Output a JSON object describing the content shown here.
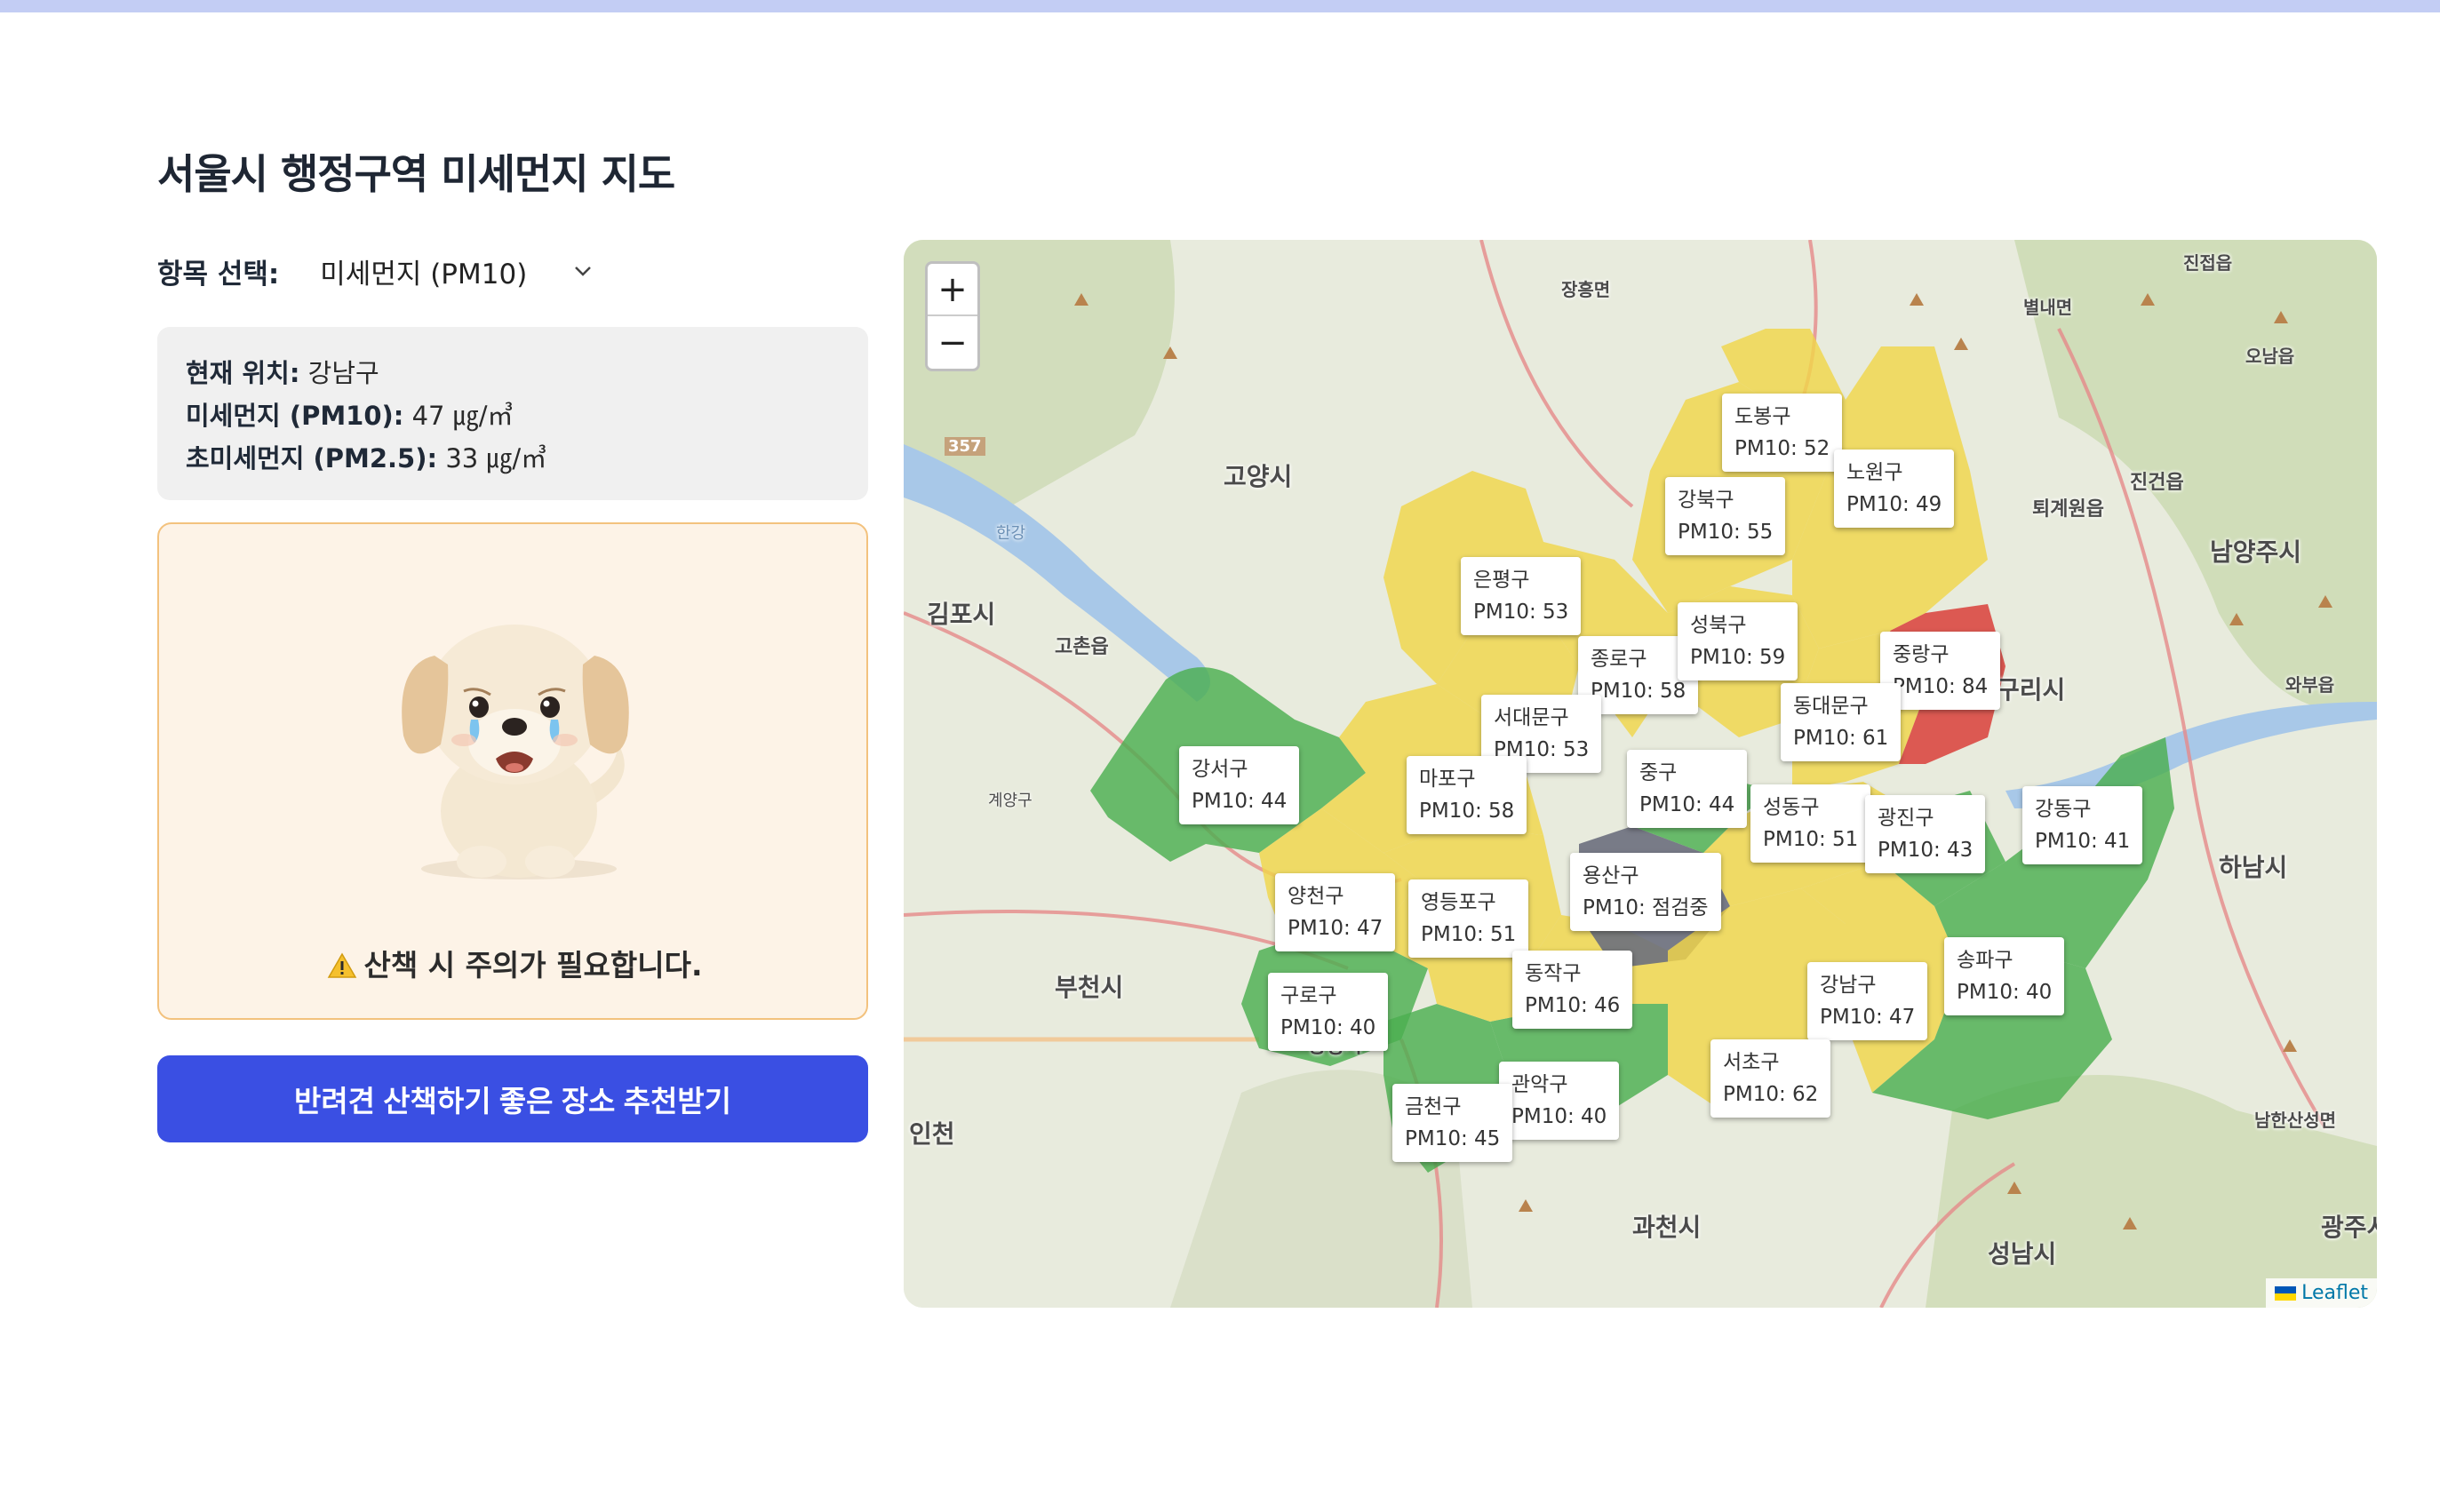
{
  "page": {
    "title": "서울시 행정구역 미세먼지 지도"
  },
  "selector": {
    "label": "항목 선택:",
    "value": "미세먼지 (PM10)"
  },
  "status": {
    "location_label": "현재 위치:",
    "location_value": "강남구",
    "pm10_label": "미세먼지 (PM10):",
    "pm10_value": "47 ㎍/㎥",
    "pm25_label": "초미세먼지 (PM2.5):",
    "pm25_value": "33 ㎍/㎥"
  },
  "advice": {
    "message": "산책 시 주의가 필요합니다.",
    "icon": "warning-icon",
    "mascot": "sad-puppy"
  },
  "cta": {
    "label": "반려견 산책하기 좋은 장소 추천받기"
  },
  "colors": {
    "good": "#4caf50",
    "moderate": "#f0d54a",
    "bad": "#d9403a",
    "unknown": "#6b6f7d",
    "accent": "#3a4fe3"
  },
  "map": {
    "zoom_in": "+",
    "zoom_out": "−",
    "attribution": "Leaflet",
    "districts": [
      {
        "name": "도봉구",
        "value": "PM10: 52",
        "level": "moderate"
      },
      {
        "name": "노원구",
        "value": "PM10: 49",
        "level": "moderate"
      },
      {
        "name": "강북구",
        "value": "PM10: 55",
        "level": "moderate"
      },
      {
        "name": "은평구",
        "value": "PM10: 53",
        "level": "moderate"
      },
      {
        "name": "종로구",
        "value": "PM10: 58",
        "level": "moderate"
      },
      {
        "name": "성북구",
        "value": "PM10: 59",
        "level": "moderate"
      },
      {
        "name": "중랑구",
        "value": "PM10: 84",
        "level": "bad"
      },
      {
        "name": "동대문구",
        "value": "PM10: 61",
        "level": "moderate"
      },
      {
        "name": "서대문구",
        "value": "PM10: 53",
        "level": "moderate"
      },
      {
        "name": "강서구",
        "value": "PM10: 44",
        "level": "good"
      },
      {
        "name": "마포구",
        "value": "PM10: 58",
        "level": "moderate"
      },
      {
        "name": "중구",
        "value": "PM10: 44",
        "level": "good"
      },
      {
        "name": "성동구",
        "value": "PM10: 51",
        "level": "moderate"
      },
      {
        "name": "광진구",
        "value": "PM10: 43",
        "level": "good"
      },
      {
        "name": "강동구",
        "value": "PM10: 41",
        "level": "good"
      },
      {
        "name": "용산구",
        "value": "PM10: 점검중",
        "level": "unknown"
      },
      {
        "name": "양천구",
        "value": "PM10: 47",
        "level": "moderate"
      },
      {
        "name": "영등포구",
        "value": "PM10: 51",
        "level": "moderate"
      },
      {
        "name": "송파구",
        "value": "PM10: 40",
        "level": "good"
      },
      {
        "name": "동작구",
        "value": "PM10: 46",
        "level": "moderate"
      },
      {
        "name": "강남구",
        "value": "PM10: 47",
        "level": "moderate"
      },
      {
        "name": "구로구",
        "value": "PM10: 40",
        "level": "good"
      },
      {
        "name": "서초구",
        "value": "PM10: 62",
        "level": "moderate"
      },
      {
        "name": "관악구",
        "value": "PM10: 40",
        "level": "good"
      },
      {
        "name": "금천구",
        "value": "PM10: 45",
        "level": "moderate"
      }
    ],
    "places": [
      "장흥면",
      "진접읍",
      "별내면",
      "오남읍",
      "고양시",
      "진건읍",
      "퇴계원읍",
      "남양주시",
      "김포시",
      "고촌읍",
      "구리시",
      "와부읍",
      "하남시",
      "부천시",
      "인천",
      "광명시",
      "과천시",
      "성남시",
      "남한산성면",
      "광주시",
      "계양구",
      "한강",
      "357"
    ]
  }
}
